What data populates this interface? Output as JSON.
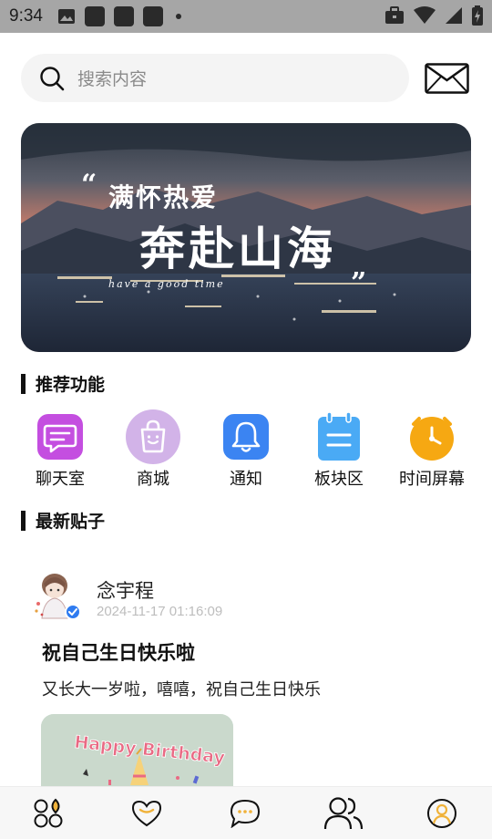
{
  "status_bar": {
    "time": "9:34"
  },
  "search": {
    "placeholder": "搜索内容"
  },
  "banner": {
    "line1": "满怀热爱",
    "line2": "奔赴山海",
    "line3": "have a good time",
    "open_quote": "“",
    "close_quote": "”"
  },
  "sections": {
    "recommended": "推荐功能",
    "latest_posts": "最新贴子"
  },
  "features": [
    {
      "label": "聊天室",
      "icon": "chat-bubble-icon",
      "color": "#c44ee0"
    },
    {
      "label": "商城",
      "icon": "shopping-bag-icon",
      "color": "#d2b3e8"
    },
    {
      "label": "通知",
      "icon": "bell-icon",
      "color": "#3b84f2"
    },
    {
      "label": "板块区",
      "icon": "notepad-icon",
      "color": "#4aaaf5"
    },
    {
      "label": "时间屏幕",
      "icon": "clock-icon",
      "color": "#f6a812"
    }
  ],
  "post": {
    "author": "念宇程",
    "timestamp": "2024-11-17 01:16:09",
    "title": "祝自己生日快乐啦",
    "body": "又长大一岁啦，嘻嘻，祝自己生日快乐",
    "image_text": "Happy Birthday"
  },
  "bottom_nav": [
    {
      "icon": "home-grid-icon"
    },
    {
      "icon": "heart-icon",
      "accent": "#f0b23a"
    },
    {
      "icon": "message-icon",
      "accent": "#f0b23a"
    },
    {
      "icon": "people-icon"
    },
    {
      "icon": "profile-icon",
      "accent": "#f0b23a"
    }
  ]
}
